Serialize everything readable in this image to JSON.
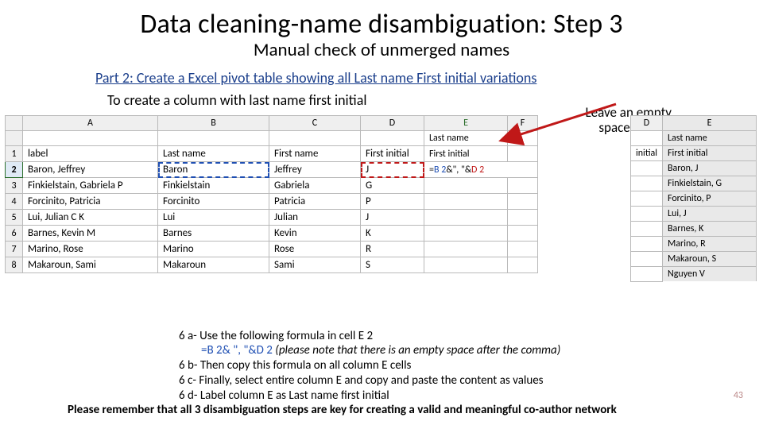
{
  "title": "Data cleaning-name disambiguation: Step 3",
  "subtitle": "Manual check of unmerged names",
  "part2_text": "Part 2: Create a Excel pivot table showing all Last name First initial variations",
  "to_create_text": "To create a column with last name first initial",
  "leave_empty_l1": "Leave an empty",
  "leave_empty_l2": "space here",
  "page_num": "43",
  "left_table": {
    "col_letters": [
      "A",
      "B",
      "C",
      "D",
      "E",
      "F"
    ],
    "E_letter": "E",
    "header2_E": "Last name",
    "headers": {
      "A": "label",
      "B": "Last name",
      "C": "First name",
      "D": "First initial",
      "E": "First initial"
    },
    "formula_pre": "=",
    "formula_b2": "B 2",
    "formula_mid": "&\", \"&",
    "formula_d2": "D 2",
    "rows": [
      {
        "n": "1"
      },
      {
        "n": "2",
        "A": "Baron, Jeffrey",
        "B": "Baron",
        "C": "Jeffrey",
        "D": "J"
      },
      {
        "n": "3",
        "A": "Finkielstain, Gabriela P",
        "B": "Finkielstain",
        "C": "Gabriela",
        "D": "G"
      },
      {
        "n": "4",
        "A": "Forcinito, Patricia",
        "B": "Forcinito",
        "C": "Patricia",
        "D": "P"
      },
      {
        "n": "5",
        "A": "Lui, Julian C K",
        "B": "Lui",
        "C": "Julian",
        "D": "J"
      },
      {
        "n": "6",
        "A": "Barnes, Kevin M",
        "B": "Barnes",
        "C": "Kevin",
        "D": "K"
      },
      {
        "n": "7",
        "A": "Marino, Rose",
        "B": "Marino",
        "C": "Rose",
        "D": "R"
      },
      {
        "n": "8",
        "A": "Makaroun, Sami",
        "B": "Makaroun",
        "C": "Sami",
        "D": "S"
      }
    ]
  },
  "right_table": {
    "D_letter": "D",
    "E_letter": "E",
    "header2_E": "Last name",
    "header_D": "initial",
    "header_E": "First initial",
    "rows": [
      "Baron, J",
      "Finkielstain, G",
      "Forcinito, P",
      "Lui, J",
      "Barnes, K",
      "Marino, R",
      "Makaroun, S",
      "Nguyen  V"
    ]
  },
  "notes": {
    "l1": "6 a- Use the following formula in cell E 2",
    "l2a": "=B 2& \", \"&D 2 ",
    "l2b": "(please note that there is an empty space after the comma)",
    "l3": "6 b- Then copy this formula on all column E cells",
    "l4": "6 c- Finally, select entire column E and copy and paste the content as values",
    "l5": "6 d- Label column E as Last name first initial",
    "l6a": "Please remember",
    "l6b": " that all 3 disambiguation steps are key for creating a valid and meaningful co-author network"
  }
}
